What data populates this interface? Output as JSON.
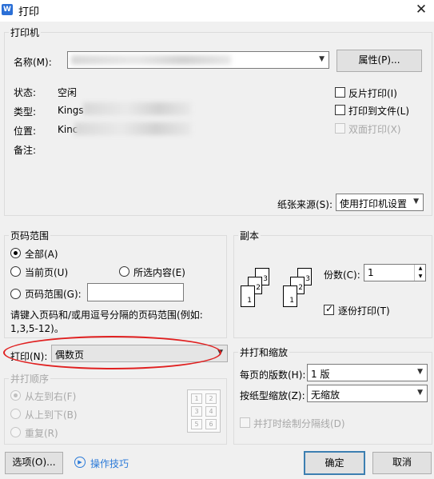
{
  "window": {
    "title": "打印",
    "close_symbol": "✕",
    "app_icon_letter": "W"
  },
  "printer": {
    "group_title": "打印机",
    "name_label": "名称(M):",
    "properties_button": "属性(P)...",
    "status_label": "状态:",
    "status_value": "空闲",
    "type_label": "类型:",
    "type_value": "Kings",
    "location_label": "位置:",
    "location_value": "Kinc",
    "comment_label": "备注:",
    "reverse_print": "反片打印(I)",
    "print_to_file": "打印到文件(L)",
    "duplex": "双面打印(X)",
    "paper_source_label": "纸张来源(S):",
    "paper_source_value": "使用打印机设置"
  },
  "page_range": {
    "group_title": "页码范围",
    "all": "全部(A)",
    "current": "当前页(U)",
    "selection": "所选内容(E)",
    "pages": "页码范围(G):",
    "hint_line1": "请键入页码和/或用逗号分隔的页码范围(例如:",
    "hint_line2": "1,3,5-12)。",
    "print_label": "打印(N):",
    "print_value": "偶数页"
  },
  "collate_order": {
    "group_title": "并打顺序",
    "left_to_right": "从左到右(F)",
    "top_to_bottom": "从上到下(B)",
    "repeat": "重复(R)",
    "preview_numbers": [
      "1",
      "2",
      "3",
      "4",
      "5",
      "6"
    ]
  },
  "copies": {
    "group_title": "副本",
    "count_label": "份数(C):",
    "count_value": "1",
    "collate": "逐份打印(T)",
    "icon_numbers": [
      "1",
      "2",
      "3"
    ]
  },
  "zoom": {
    "group_title": "并打和缩放",
    "pages_per_sheet_label": "每页的版数(H):",
    "pages_per_sheet_value": "1 版",
    "scale_label": "按纸型缩放(Z):",
    "scale_value": "无缩放",
    "draw_borders": "并打时绘制分隔线(D)"
  },
  "footer": {
    "options_button": "选项(O)...",
    "tips_link": "操作技巧",
    "ok_button": "确定",
    "cancel_button": "取消"
  }
}
